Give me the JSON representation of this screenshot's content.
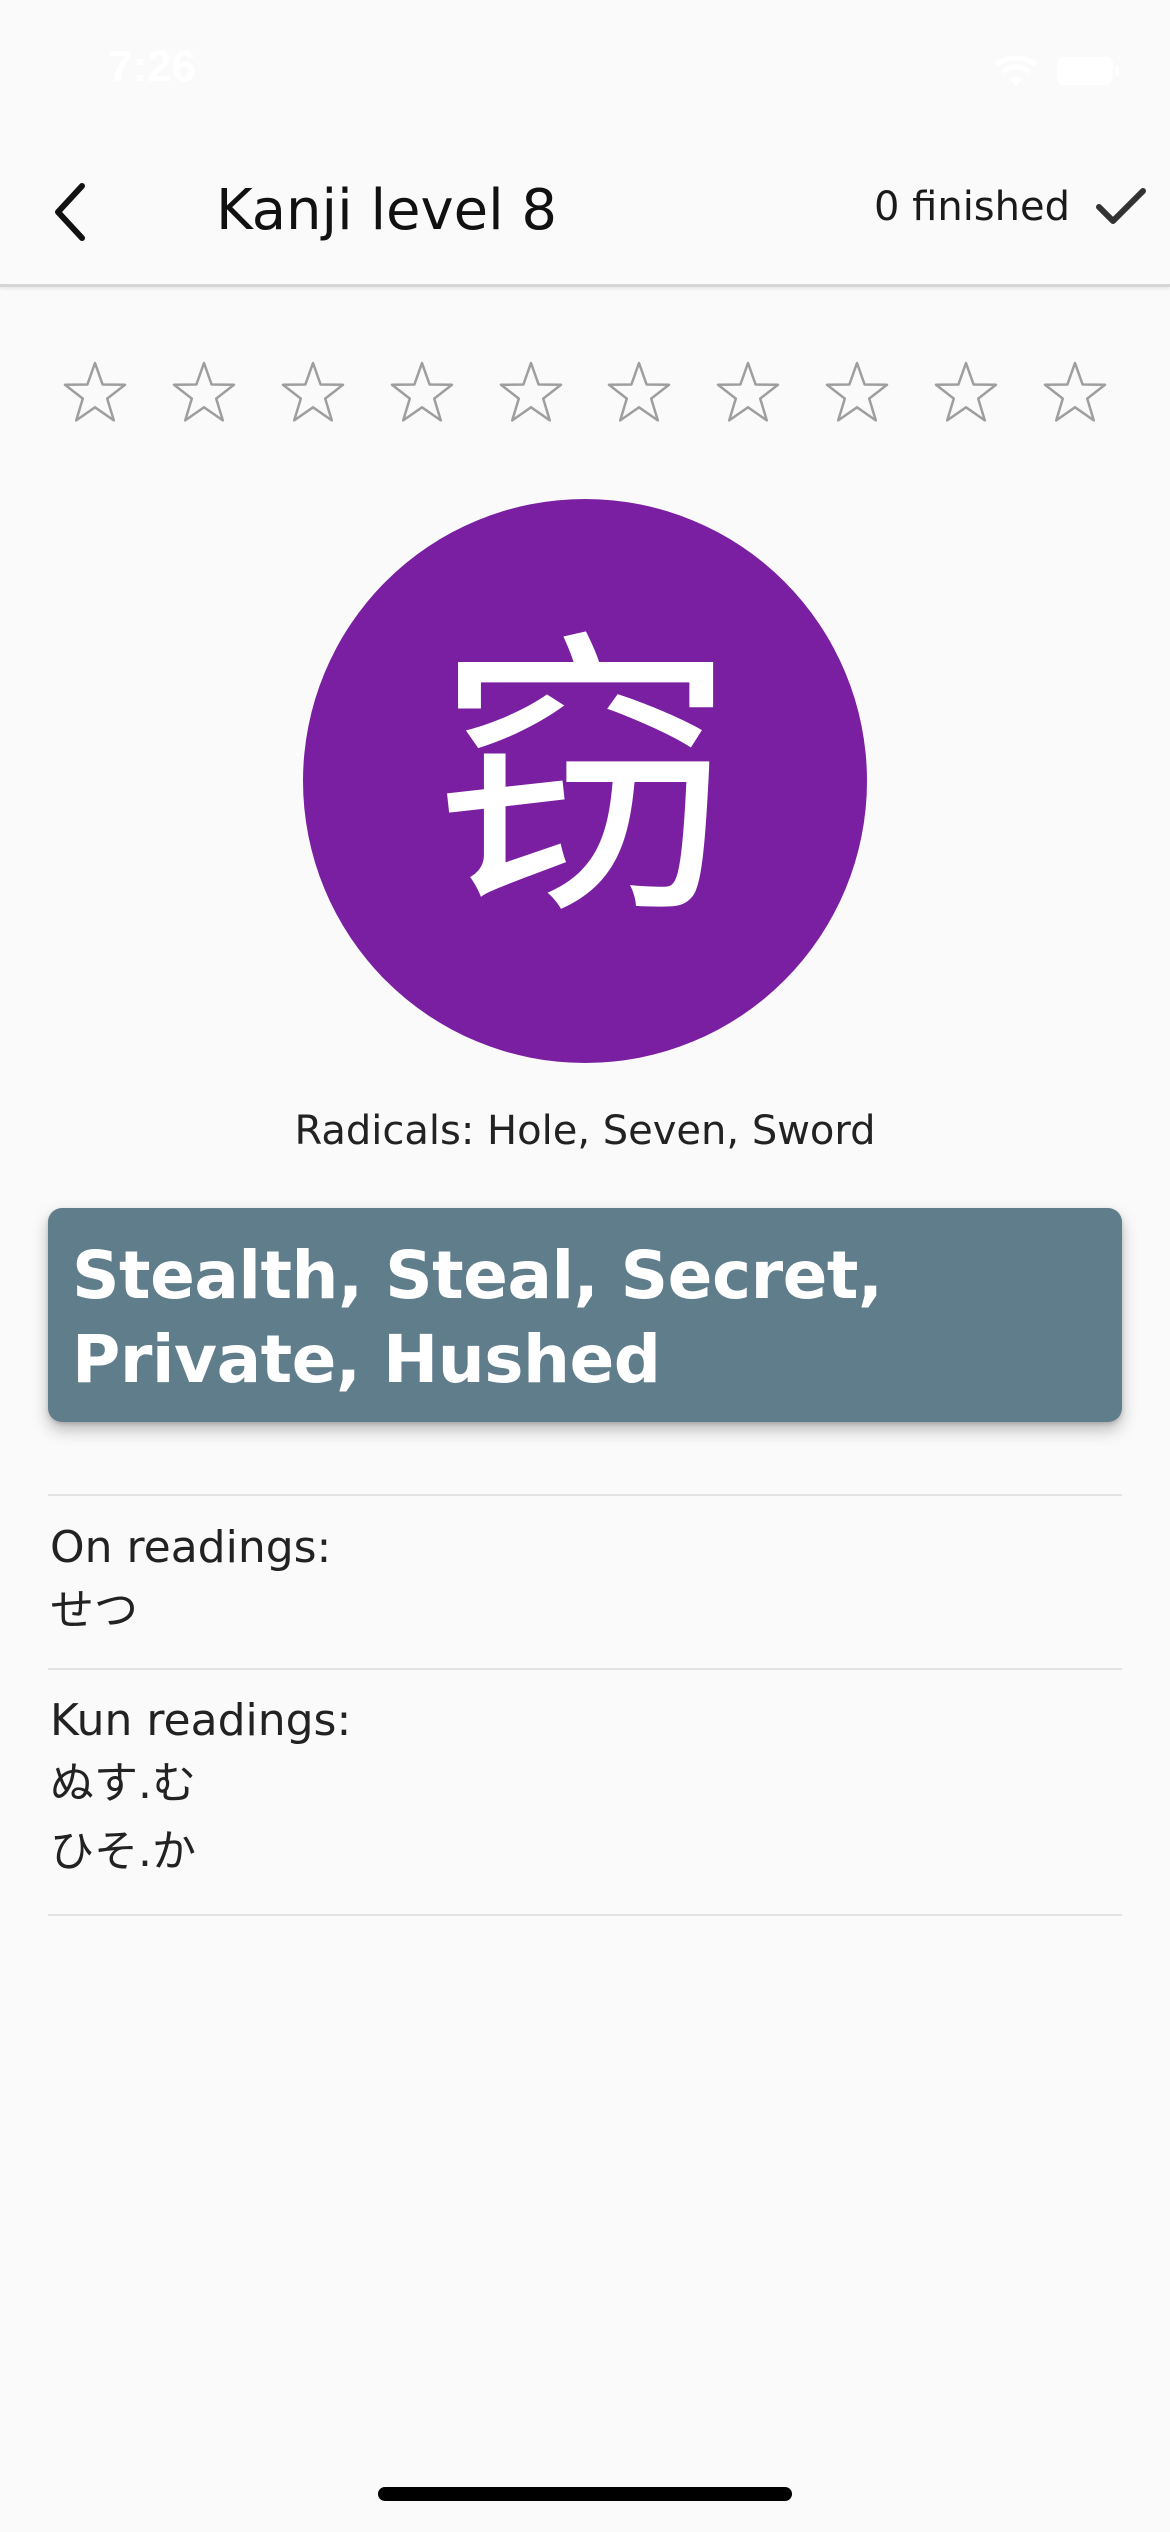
{
  "status_bar": {
    "time": "7:26"
  },
  "app_bar": {
    "title": "Kanji level 8",
    "finished_label": "0 finished"
  },
  "rating": {
    "max_stars": 10,
    "filled": 0
  },
  "kanji": {
    "character": "窃",
    "circle_color": "#7b1fa2"
  },
  "radicals_text": "Radicals: Hole, Seven, Sword",
  "meaning": {
    "text": "Stealth, Steal, Secret, Private, Hushed",
    "card_color": "#607d8b"
  },
  "on_readings": {
    "label": "On readings:",
    "values": [
      "せつ"
    ]
  },
  "kun_readings": {
    "label": "Kun readings:",
    "values": [
      "ぬす.む",
      "ひそ.か"
    ]
  }
}
